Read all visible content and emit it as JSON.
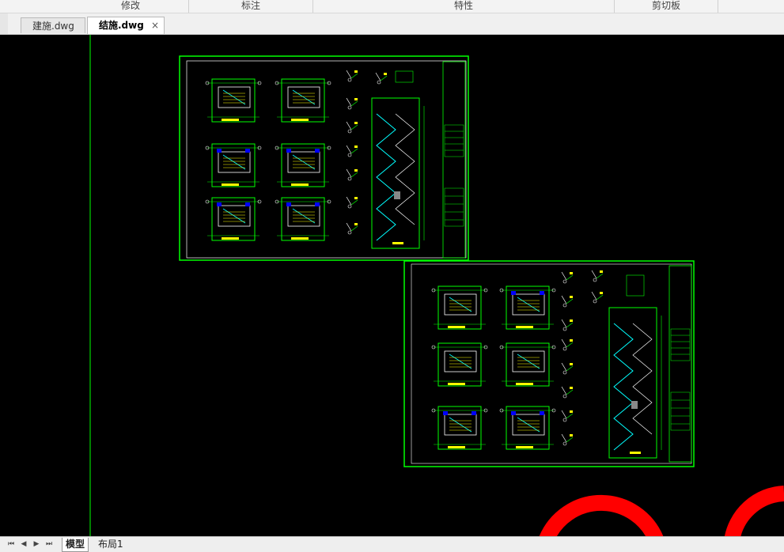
{
  "ribbon": {
    "groups": [
      {
        "label": "修改"
      },
      {
        "label": "标注"
      },
      {
        "label": "特性"
      },
      {
        "label": "剪切板"
      }
    ]
  },
  "tabs": [
    {
      "label": "建施.dwg",
      "active": false
    },
    {
      "label": "结施.dwg",
      "active": true,
      "close": "×"
    }
  ],
  "canvas": {
    "background": "#000000",
    "linework_color": "#00ff00",
    "annotation_color": "#ffff00",
    "accent_color": "#0000ff",
    "highlight_color": "#ff0000"
  },
  "status": {
    "nav_icons": [
      "first-icon",
      "prev-icon",
      "next-icon",
      "last-icon"
    ],
    "layout_tabs": [
      {
        "label": "模型",
        "active": true
      },
      {
        "label": "布局1",
        "active": false
      }
    ]
  }
}
